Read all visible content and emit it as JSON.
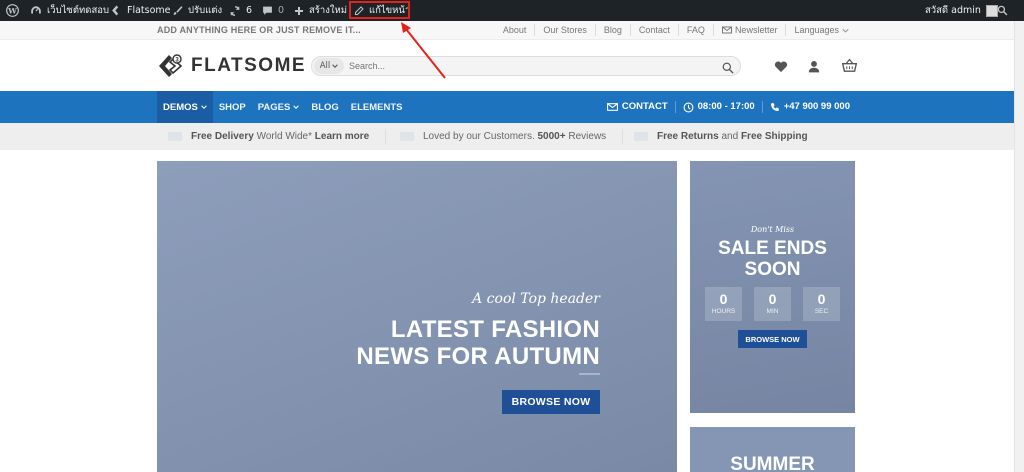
{
  "admin_bar": {
    "site_name": "เว็บไซต์ทดสอบ",
    "theme": "Flatsome",
    "customize": "ปรับแต่ง",
    "updates_count": "6",
    "comments_count": "0",
    "new": "สร้างใหม่",
    "edit_page": "แก้ไขหน้า",
    "greeting": "สวัสดี admin"
  },
  "topbar": {
    "left_text": "ADD ANYTHING HERE OR JUST REMOVE IT...",
    "links": [
      "About",
      "Our Stores",
      "Blog",
      "Contact",
      "FAQ"
    ],
    "newsletter": "Newsletter",
    "languages": "Languages"
  },
  "header": {
    "logo": "FLATSOME",
    "category_select": "All",
    "search_placeholder": "Search..."
  },
  "main_nav": {
    "items": [
      "DEMOS",
      "SHOP",
      "PAGES",
      "BLOG",
      "ELEMENTS"
    ],
    "contact": "CONTACT",
    "hours": "08:00 - 17:00",
    "phone": "+47 900 99 000"
  },
  "benefits": {
    "b1_bold": "Free Delivery",
    "b1_rest": "World Wide*",
    "b1_link": "Learn more",
    "b2_text": "Loved by our Customers.",
    "b2_bold": "5000+",
    "b2_rest": "Reviews",
    "b3_bold1": "Free Returns",
    "b3_mid": "and",
    "b3_bold2": "Free Shipping"
  },
  "hero": {
    "tagline": "A cool Top header",
    "title_line1": "LATEST FASHION",
    "title_line2": "NEWS FOR AUTUMN",
    "button": "BROWSE NOW"
  },
  "side_banner": {
    "kicker": "Don't Miss",
    "title_line1": "SALE ENDS",
    "title_line2": "SOON",
    "countdown": [
      {
        "value": "0",
        "label": "HOURS"
      },
      {
        "value": "0",
        "label": "MIN"
      },
      {
        "value": "0",
        "label": "SEC"
      }
    ],
    "button": "BROWSE NOW"
  },
  "side_banner_2": {
    "title": "SUMMER"
  },
  "colors": {
    "admin_bar": "#1d2327",
    "primary_blue": "#1e73be",
    "button_blue": "#1f4f96",
    "highlight_red": "#e2231a"
  }
}
